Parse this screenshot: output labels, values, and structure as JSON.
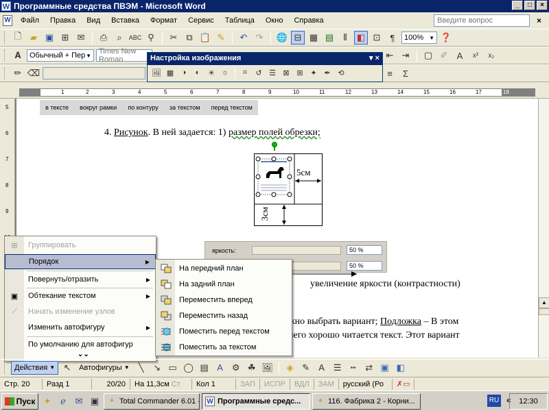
{
  "window": {
    "title": "Программные средства ПВЭМ - Microsoft Word",
    "app_icon": "W",
    "buttons": {
      "minimize": "_",
      "maximize": "□",
      "close": "×"
    }
  },
  "menubar": {
    "items": [
      "Файл",
      "Правка",
      "Вид",
      "Вставка",
      "Формат",
      "Сервис",
      "Таблица",
      "Окно",
      "Справка"
    ],
    "help_placeholder": "Введите вопрос",
    "close_doc": "×"
  },
  "standard_toolbar": {
    "zoom": "100%"
  },
  "formatting_toolbar": {
    "style": "Обычный + Пер",
    "font": "Times New Roman"
  },
  "image_toolbar": {
    "title": "Настройка изображения",
    "controls": "▾ ×"
  },
  "ruler": {
    "marks": [
      "1",
      "2",
      "3",
      "4",
      "5",
      "6",
      "7",
      "8",
      "9",
      "10",
      "11",
      "12",
      "13",
      "14",
      "15",
      "16",
      "17",
      "18"
    ]
  },
  "vertical_ruler": {
    "marks": [
      "5",
      "6",
      "7",
      "8",
      "9",
      "10",
      "11",
      "12"
    ]
  },
  "wrap_strip": [
    "в тексте",
    "вокруг рамки",
    "по контуру",
    "за текстом",
    "перед текстом"
  ],
  "document": {
    "line1_prefix": "4. ",
    "line1_link": "Рисунок",
    "line1_mid": ". В ней задается: 1) ",
    "line1_underlined": "размер полей обрезки;",
    "dim_right": "5см",
    "dim_bottom": "3см",
    "text_brightness": "увеличение яркости (контрастности)",
    "text_line3_pre": "жно выбрать вариант; ",
    "text_line3_link": "Подложка",
    "text_line3_post": " – В этом",
    "text_line4": "него хорошо читается текст. Этот вариант"
  },
  "brightness_panel": {
    "label": "яркость:",
    "value1": "50 %",
    "value2": "50 %"
  },
  "main_menu": {
    "items": [
      {
        "label": "Группировать",
        "disabled": true,
        "submenu": false
      },
      {
        "label": "Порядок",
        "disabled": false,
        "submenu": true,
        "highlighted": true
      },
      {
        "label": "Повернуть/отразить",
        "disabled": false,
        "submenu": true
      },
      {
        "label": "Обтекание текстом",
        "disabled": false,
        "submenu": true
      },
      {
        "label": "Начать изменение узлов",
        "disabled": true,
        "submenu": false
      },
      {
        "label": "Изменить автофигуру",
        "disabled": false,
        "submenu": true
      },
      {
        "label": "По умолчанию для автофигур",
        "disabled": false,
        "submenu": false
      }
    ],
    "expand": "⌄⌄"
  },
  "order_submenu": {
    "items": [
      "На передний план",
      "На задний план",
      "Переместить вперед",
      "Переместить назад",
      "Поместить перед текстом",
      "Поместить за текстом"
    ]
  },
  "drawing_toolbar": {
    "actions": "Действия",
    "autoshapes": "Автофигуры"
  },
  "statusbar": {
    "page": "Стр. 20",
    "section": "Разд 1",
    "pages": "20/20",
    "at": "На 11,3см",
    "line": "Ст",
    "col": "Кол 1",
    "rec": "ЗАП",
    "trk": "ИСПР",
    "ext": "ВДЛ",
    "ovr": "ЗАМ",
    "lang": "русский (Ро"
  },
  "taskbar": {
    "start": "Пуск",
    "tasks": [
      {
        "label": "Total Commander 6.01 - ...",
        "active": false
      },
      {
        "label": "Программные средс...",
        "active": true
      },
      {
        "label": "116. Фабрика 2 - Корни...",
        "active": false
      }
    ],
    "lang": "RU",
    "chevron": "«",
    "time": "12:30"
  },
  "colors": {
    "titlebar": "#0A246A",
    "menu_highlight": "#B6BDD2",
    "selection_handle": "#00A000"
  }
}
